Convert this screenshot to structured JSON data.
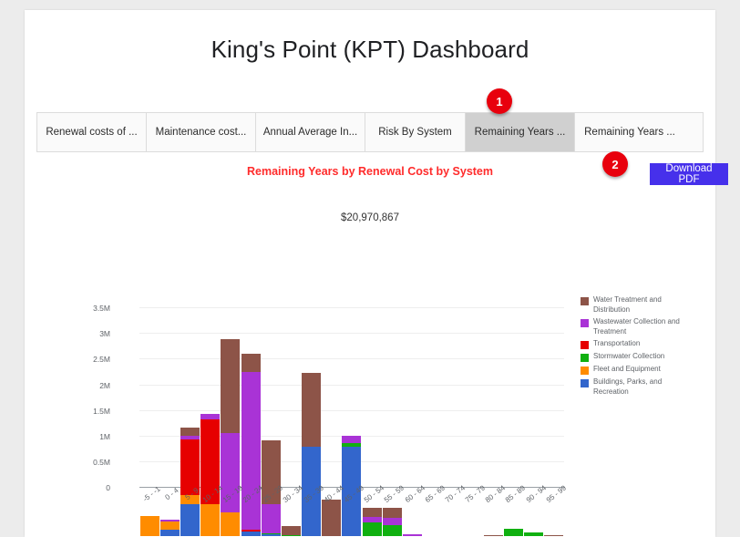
{
  "header": {
    "title": "King's Point (KPT) Dashboard"
  },
  "tabs": [
    {
      "label": "Renewal costs of ...",
      "active": false
    },
    {
      "label": "Maintenance cost...",
      "active": false
    },
    {
      "label": "Annual Average In...",
      "active": false
    },
    {
      "label": "Risk By System",
      "active": false
    },
    {
      "label": "Remaining Years ...",
      "active": true
    },
    {
      "label": "Remaining Years ...",
      "active": false
    }
  ],
  "badges": [
    {
      "id": "1",
      "label": "1",
      "color": "#e8000d"
    },
    {
      "id": "2",
      "label": "2",
      "color": "#e8000d"
    }
  ],
  "toolbar": {
    "download_label": "Download PDF",
    "download_color": "#4630eb"
  },
  "chart_data": {
    "type": "bar",
    "stacked": true,
    "title": "Remaining Years by Renewal Cost by System",
    "title_color": "#ff2b2b",
    "subtitle": "$20,970,867",
    "xlabel": "",
    "ylabel": "",
    "ylim": [
      0,
      3500000
    ],
    "grid": true,
    "legend_position": "right",
    "ytick_labels": [
      "0",
      "0.5M",
      "1M",
      "1.5M",
      "2M",
      "2.5M",
      "3M",
      "3.5M"
    ],
    "ytick_values": [
      0,
      500000,
      1000000,
      1500000,
      2000000,
      2500000,
      3000000,
      3500000
    ],
    "categories": [
      "-5 - -1",
      "0 - 4",
      "5 - 9",
      "10 - 14",
      "15 - 19",
      "20 - 24",
      "25 - 29",
      "30 - 34",
      "35 - 39",
      "40 - 44",
      "45 - 49",
      "50 - 54",
      "55 - 59",
      "60 - 64",
      "65 - 69",
      "70 - 74",
      "75 - 79",
      "80 - 84",
      "85 - 89",
      "90 - 94",
      "95 - 99"
    ],
    "series": [
      {
        "name": "Buildings, Parks, and Recreation",
        "color": "#3366cc",
        "values": [
          0,
          130000,
          620000,
          0,
          0,
          90000,
          40000,
          0,
          1750000,
          0,
          1750000,
          0,
          0,
          0,
          0,
          0,
          0,
          0,
          0,
          0,
          0
        ]
      },
      {
        "name": "Fleet and Equipment",
        "color": "#ff8c00",
        "values": [
          400000,
          150000,
          180000,
          620000,
          470000,
          0,
          0,
          0,
          0,
          0,
          0,
          0,
          0,
          0,
          0,
          0,
          0,
          0,
          0,
          0,
          0
        ]
      },
      {
        "name": "Stormwater Collection",
        "color": "#10b010",
        "values": [
          0,
          0,
          0,
          0,
          0,
          0,
          20000,
          20000,
          0,
          0,
          60000,
          260000,
          210000,
          0,
          0,
          0,
          0,
          0,
          140000,
          70000,
          0
        ]
      },
      {
        "name": "Transportation",
        "color": "#e60000",
        "values": [
          0,
          0,
          1090000,
          1650000,
          0,
          30000,
          0,
          0,
          0,
          0,
          0,
          0,
          0,
          0,
          0,
          0,
          0,
          0,
          0,
          0,
          0
        ]
      },
      {
        "name": "Wastewater Collection and Treatment",
        "color": "#a933d6",
        "values": [
          0,
          40000,
          60000,
          110000,
          1540000,
          3080000,
          570000,
          0,
          0,
          0,
          140000,
          120000,
          140000,
          40000,
          0,
          0,
          0,
          0,
          0,
          0,
          0
        ]
      },
      {
        "name": "Water Treatment and Distribution",
        "color": "#8d5448",
        "values": [
          0,
          0,
          170000,
          0,
          1840000,
          360000,
          1230000,
          180000,
          1430000,
          710000,
          0,
          170000,
          200000,
          0,
          0,
          0,
          0,
          20000,
          0,
          0,
          10000
        ]
      }
    ]
  }
}
